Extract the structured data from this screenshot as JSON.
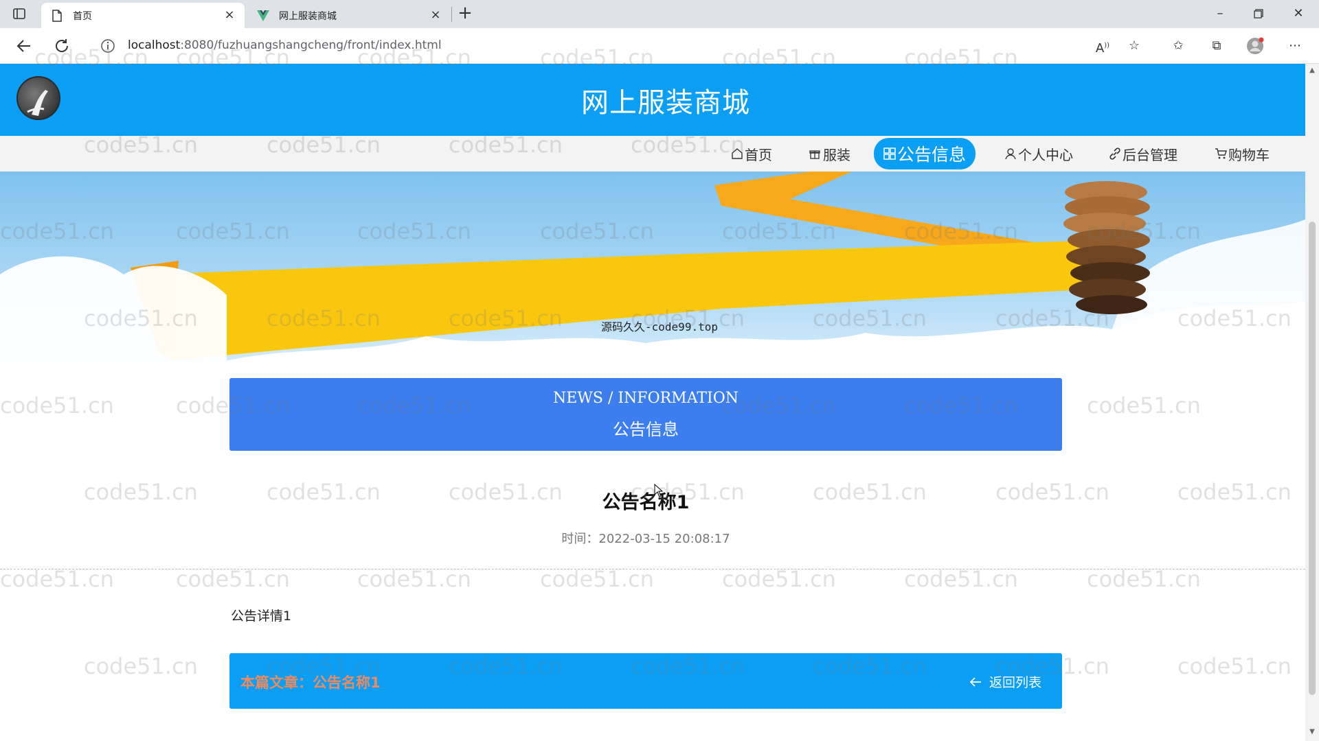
{
  "browser": {
    "tabs": [
      {
        "title": "首页",
        "active": true,
        "icon": "page-icon"
      },
      {
        "title": "网上服装商城",
        "active": false,
        "icon": "vue-logo-icon"
      }
    ],
    "url_host": "localhost",
    "url_rest": ":8080/fuzhuangshangcheng/front/index.html"
  },
  "site": {
    "title": "网上服装商城",
    "accent_color": "#0a9ff5",
    "nav": [
      {
        "label": "首页",
        "icon": "home-icon"
      },
      {
        "label": "服装",
        "icon": "gift-icon"
      },
      {
        "label": "公告信息",
        "icon": "grid-icon",
        "active": true
      },
      {
        "label": "个人中心",
        "icon": "user-icon"
      },
      {
        "label": "后台管理",
        "icon": "link-icon"
      },
      {
        "label": "购物车",
        "icon": "cart-icon"
      }
    ]
  },
  "banner": {
    "caption": "源码久久-code99.top",
    "slide_count": 3,
    "active_slide": 3
  },
  "news_header": {
    "english": "NEWS / INFORMATION",
    "chinese": "公告信息",
    "color": "#3c7ef0"
  },
  "article": {
    "title": "公告名称1",
    "time": "时间：2022-03-15 20:08:17",
    "body": "公告详情1"
  },
  "footer": {
    "current_article": "本篇文章：公告名称1",
    "back_label": "返回列表"
  },
  "watermark": {
    "text": "code51.cn"
  }
}
